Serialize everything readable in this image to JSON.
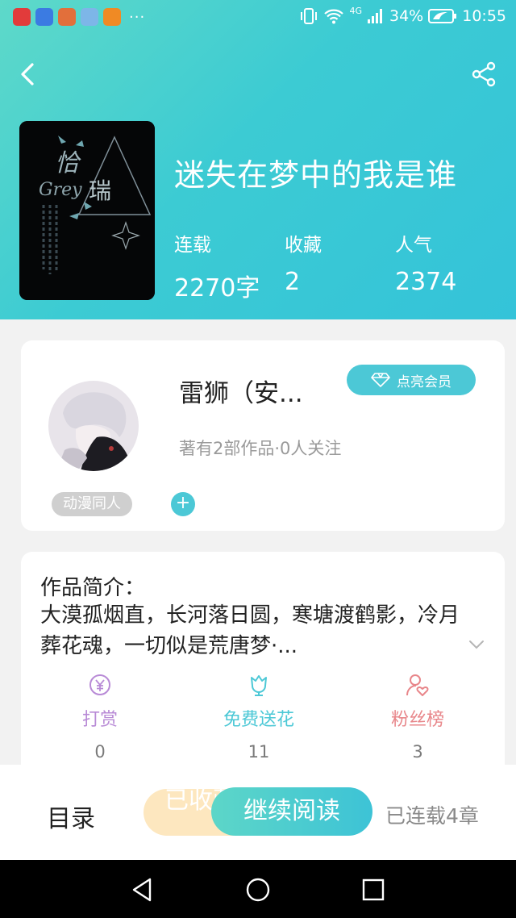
{
  "status_bar": {
    "network": "4G",
    "battery": "34%",
    "time": "10:55",
    "apps": [
      {
        "icon": "toutiao-app-icon",
        "color": "#e23b3b"
      },
      {
        "icon": "sogou-app-icon",
        "color": "#3b7be2"
      },
      {
        "icon": "game-app-icon",
        "color": "#e26f3b"
      },
      {
        "icon": "music-app-icon",
        "color": "#7db6e8"
      },
      {
        "icon": "video-app-icon",
        "color": "#f08a24"
      }
    ],
    "more": "···"
  },
  "header": {
    "back_icon": "chevron-left-icon",
    "share_icon": "share-icon"
  },
  "book": {
    "title": "迷失在梦中的我是谁",
    "cover_icon": "book-cover-image",
    "stats": [
      {
        "label": "连载",
        "value": "2270字"
      },
      {
        "label": "收藏",
        "value": "2"
      },
      {
        "label": "人气",
        "value": "2374"
      }
    ]
  },
  "author": {
    "name": "雷狮（安...",
    "vip_label": "点亮会员",
    "vip_icon": "diamond-icon",
    "meta": "著有2部作品·0人关注",
    "tag": "动漫同人",
    "add_tag_label": "+"
  },
  "intro": {
    "title": "作品简介：",
    "text": "大漠孤烟直，长河落日圆，寒塘渡鹤影，冷月葬花魂，一切似是荒唐梦·...",
    "expand_icon": "chevron-down-icon",
    "actions": [
      {
        "label": "打赏",
        "count": "0",
        "icon": "yen-coin-icon",
        "color": "#b88ad6"
      },
      {
        "label": "免费送花",
        "count": "11",
        "icon": "flower-icon",
        "color": "#4cc8d6"
      },
      {
        "label": "粉丝榜",
        "count": "3",
        "icon": "fan-heart-icon",
        "color": "#e8868a"
      }
    ]
  },
  "bottom": {
    "catalog": "目录",
    "favorited": "已收藏",
    "continue_reading": "继续阅读",
    "chapters": "已连载4章"
  },
  "nav": {
    "back": "nav-back-icon",
    "home": "nav-home-icon",
    "recent": "nav-recent-icon"
  },
  "colors": {
    "accent": "#4cc8d6",
    "hero_start": "#5ed9c9",
    "hero_end": "#34c3d9"
  }
}
